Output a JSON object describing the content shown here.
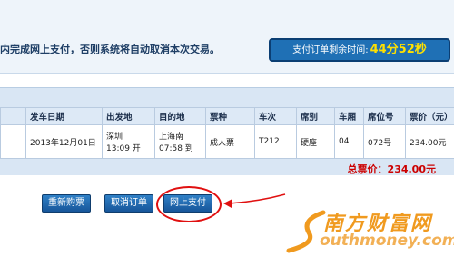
{
  "notice": {
    "message": "内完成网上支付，否则系统将自动取消本次交易。",
    "timer_label": "支付订单剩余时间:",
    "timer_value": "44分52秒"
  },
  "ticket_table": {
    "headers": [
      "发车日期",
      "出发地",
      "目的地",
      "票种",
      "车次",
      "席别",
      "车厢",
      "席位号",
      "票价（元）"
    ],
    "row": {
      "date": "2013年12月01日",
      "from_station": "深圳",
      "from_time": "13:09 开",
      "to_station": "上海南",
      "to_time": "07:58 到",
      "ticket_type": "成人票",
      "train_no": "T212",
      "seat_class": "硬座",
      "car": "04",
      "seat_no": "072号",
      "price": "234.00元"
    },
    "total": "总票价：234.00元"
  },
  "actions": {
    "rebuy": "重新购票",
    "cancel": "取消订单",
    "pay": "网上支付"
  },
  "watermark": {
    "chinese": "南方财富网",
    "english": "outhmoney.com"
  },
  "colors": {
    "accent": "#1f70b5",
    "timer_highlight": "#ffe100",
    "total_red": "#cc0000",
    "annotation_red": "#e01010",
    "watermark_orange": "#f09a1f"
  }
}
